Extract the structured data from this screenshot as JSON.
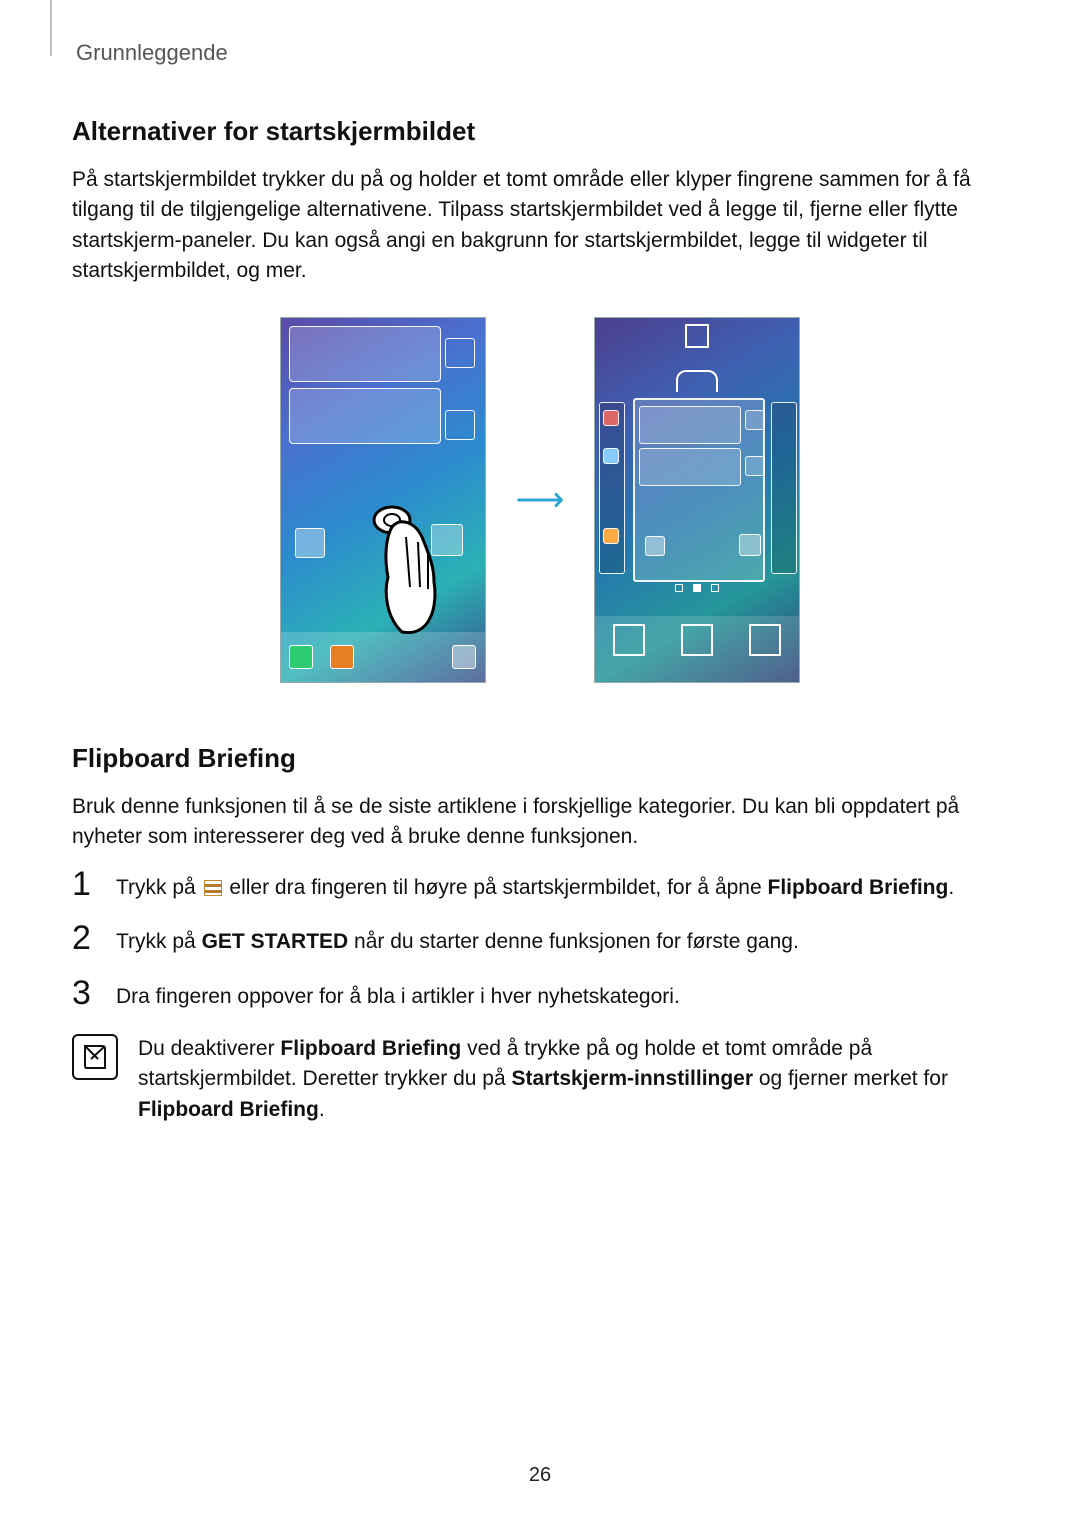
{
  "header": "Grunnleggende",
  "section1": {
    "title": "Alternativer for startskjermbildet",
    "para": "På startskjermbildet trykker du på og holder et tomt område eller klyper fingrene sammen for å få tilgang til de tilgjengelige alternativene. Tilpass startskjermbildet ved å legge til, fjerne eller flytte startskjerm-paneler. Du kan også angi en bakgrunn for startskjermbildet, legge til widgeter til startskjermbildet, og mer."
  },
  "section2": {
    "title": "Flipboard Briefing",
    "para": "Bruk denne funksjonen til å se de siste artiklene i forskjellige kategorier. Du kan bli oppdatert på nyheter som interesserer deg ved å bruke denne funksjonen.",
    "steps": {
      "s1_a": "Trykk på ",
      "s1_b": " eller dra fingeren til høyre på startskjermbildet, for å åpne ",
      "s1_bold": "Flipboard Briefing",
      "s1_c": ".",
      "s2_a": "Trykk på ",
      "s2_bold": "GET STARTED",
      "s2_b": " når du starter denne funksjonen for første gang.",
      "s3": "Dra fingeren oppover for å bla i artikler i hver nyhetskategori."
    },
    "note": {
      "a": "Du deaktiverer ",
      "b1": "Flipboard Briefing",
      "c": " ved å trykke på og holde et tomt område på startskjermbildet. Deretter trykker du på ",
      "b2": "Startskjerm-innstillinger",
      "d": " og fjerner merket for ",
      "b3": "Flipboard Briefing",
      "e": "."
    }
  },
  "numbers": {
    "n1": "1",
    "n2": "2",
    "n3": "3"
  },
  "page_number": "26"
}
